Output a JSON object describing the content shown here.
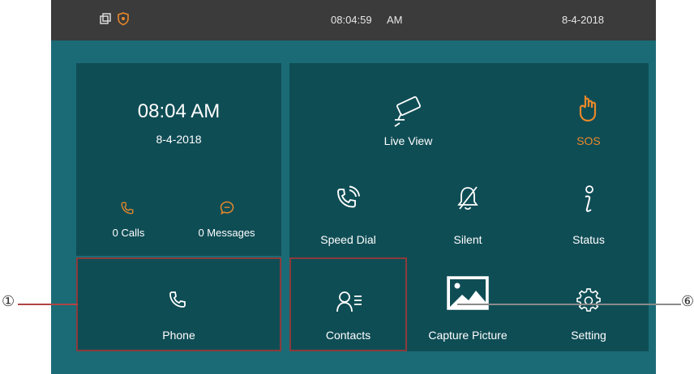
{
  "status_bar": {
    "time": "08:04:59",
    "ampm": "AM",
    "date": "8-4-2018",
    "icons": [
      "window-icon",
      "shield-icon"
    ]
  },
  "clock_panel": {
    "time": "08:04 AM",
    "date": "8-4-2018",
    "calls_label": "0 Calls",
    "messages_label": "0 Messages",
    "calls_icon": "phone-icon",
    "messages_icon": "message-bubble-icon"
  },
  "tiles": {
    "phone": "Phone",
    "live_view": "Live View",
    "sos": "SOS",
    "speed_dial": "Speed Dial",
    "silent": "Silent",
    "status": "Status",
    "contacts": "Contacts",
    "capture_picture": "Capture Picture",
    "setting": "Setting"
  },
  "callouts": {
    "left": "①",
    "right": "⑥"
  },
  "colors": {
    "screen_bg": "#1a6b76",
    "tile_bg": "#0f4d55",
    "topbar_bg": "#3b3b3b",
    "accent_orange": "#e8882a",
    "highlight_border": "#8c3a3a"
  }
}
